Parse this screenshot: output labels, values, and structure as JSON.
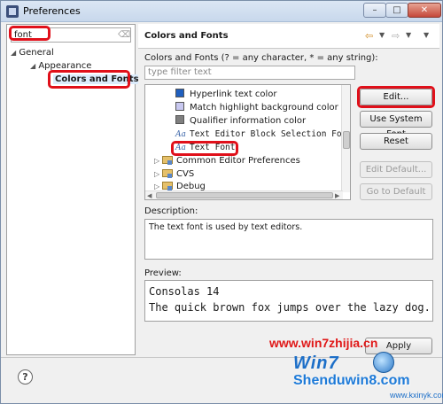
{
  "window": {
    "title": "Preferences",
    "minimize": "–",
    "maximize": "□",
    "close": "✕"
  },
  "left": {
    "filter_value": "font",
    "tree": [
      {
        "label": "General",
        "twisty": "◢"
      },
      {
        "label": "Appearance",
        "twisty": "◢"
      },
      {
        "label": "Colors and Fonts",
        "selected": true
      }
    ]
  },
  "right": {
    "title": "Colors and Fonts",
    "hint": "Colors and Fonts (? = any character, * = any string):",
    "filter_placeholder": "type filter text",
    "items": [
      {
        "label": "Hyperlink text color",
        "swatch": "#1f5fbf"
      },
      {
        "label": "Match highlight background color",
        "swatch": "#c8c8f0"
      },
      {
        "label": "Qualifier information color",
        "swatch": "#7f7f7f"
      },
      {
        "label": "Text Editor Block Selection Font",
        "icon": "Aa"
      },
      {
        "label": "Text Font",
        "icon": "Aa"
      },
      {
        "label": "Common Editor Preferences",
        "twisty": "▷"
      },
      {
        "label": "CVS",
        "twisty": "▷"
      },
      {
        "label": "Debug",
        "twisty": "▷"
      }
    ],
    "buttons": {
      "edit": "Edit...",
      "use_system": "Use System Font",
      "reset": "Reset",
      "edit_default": "Edit Default...",
      "go_to_default": "Go to Default"
    },
    "description_label": "Description:",
    "description_text": "The text font is used by text editors.",
    "preview_label": "Preview:",
    "preview_line1": "Consolas 14",
    "preview_line2": "The quick brown fox jumps over the lazy dog."
  },
  "footer": {
    "help": "?",
    "apply": "Apply"
  },
  "watermark": {
    "line1": "www.win7zhijia.cn",
    "logo": "Win7",
    "line2": "Shenduwin8.com",
    "line3": "www.kxinyk.com"
  },
  "colors": {
    "highlight": "#e0101a",
    "selection": "#dcecfc"
  }
}
